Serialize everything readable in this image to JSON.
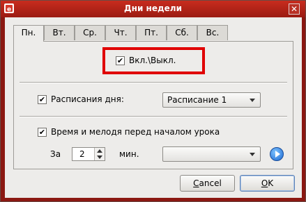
{
  "window": {
    "title": "Дни недели",
    "close_symbol": "✕",
    "icon": "app-icon"
  },
  "tabs": [
    {
      "label": "Пн.",
      "active": true
    },
    {
      "label": "Вт.",
      "active": false
    },
    {
      "label": "Ср.",
      "active": false
    },
    {
      "label": "Чт.",
      "active": false
    },
    {
      "label": "Пт.",
      "active": false
    },
    {
      "label": "Сб.",
      "active": false
    },
    {
      "label": "Вс.",
      "active": false
    }
  ],
  "page": {
    "enable": {
      "label": "Вкл.\\Выкл.",
      "checked": true,
      "check_glyph": "✔"
    },
    "schedule": {
      "label": "Расписания дня:",
      "checked": true,
      "check_glyph": "✔",
      "value": "Расписание 1"
    },
    "melody": {
      "label": "Время и мелодя перед началом урока",
      "checked": true,
      "check_glyph": "✔"
    },
    "before": {
      "prefix": "За",
      "minutes": "2",
      "unit": "мин.",
      "melody_value": ""
    }
  },
  "buttons": {
    "cancel_first": "C",
    "cancel_rest": "ancel",
    "ok_first": "O",
    "ok_rest": "K"
  },
  "colors": {
    "titlebar": "#b52418",
    "highlight": "#e00000",
    "play_button": "#1a66d0"
  }
}
